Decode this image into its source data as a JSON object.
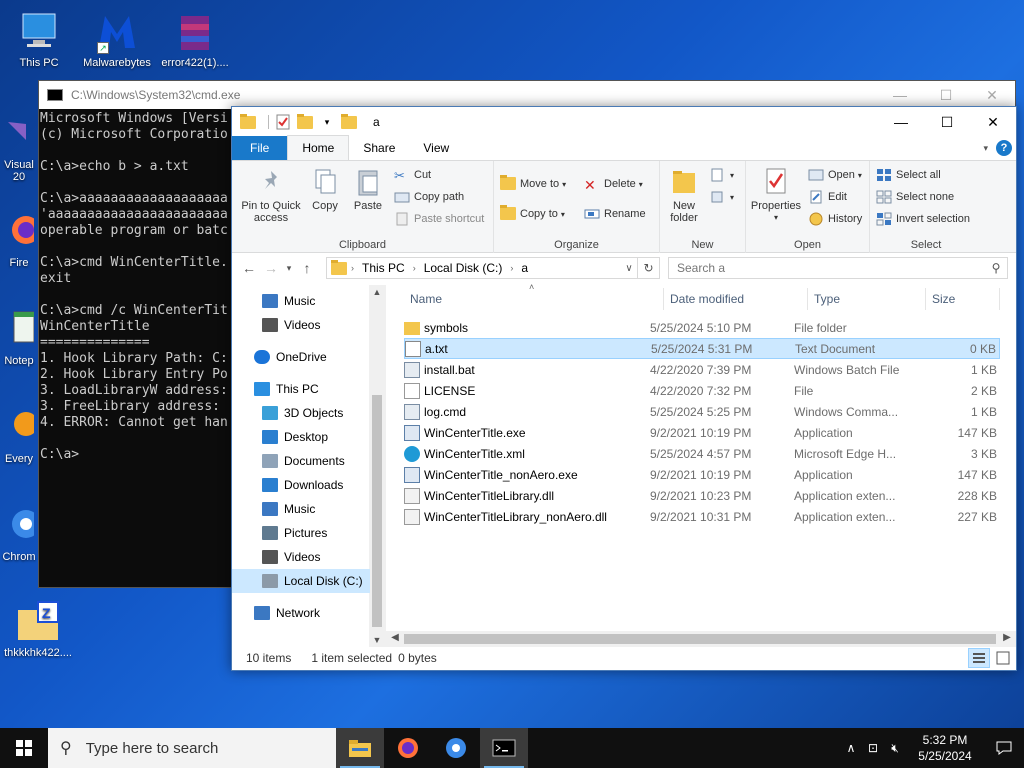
{
  "desktop": {
    "icons": [
      {
        "label": "This PC",
        "icon": "monitor-icon"
      },
      {
        "label": "Malwarebytes",
        "icon": "malwarebytes-icon"
      },
      {
        "label": "error422(1)....",
        "icon": "winrar-archive-icon"
      },
      {
        "label": "Visual 20",
        "icon": "visual-studio-icon"
      },
      {
        "label": "Fire",
        "icon": "firefox-icon"
      },
      {
        "label": "Notep",
        "icon": "notepad-icon"
      },
      {
        "label": "Every",
        "icon": "everything-icon"
      },
      {
        "label": "Chrom",
        "icon": "chrome-icon"
      },
      {
        "label": "thkkkhk422....",
        "icon": "zip-folder-icon"
      }
    ]
  },
  "cmd": {
    "title": "C:\\Windows\\System32\\cmd.exe",
    "lines": [
      "Microsoft Windows [Versi",
      "(c) Microsoft Corporatio",
      "",
      "C:\\a>echo b > a.txt",
      "",
      "C:\\a>aaaaaaaaaaaaaaaaaaa",
      "'aaaaaaaaaaaaaaaaaaaaaaa",
      "operable program or batc",
      "",
      "C:\\a>cmd WinCenterTitle.",
      "exit",
      "",
      "C:\\a>cmd /c WinCenterTit",
      "WinCenterTitle",
      "==============",
      "1. Hook Library Path: C:",
      "2. Hook Library Entry Po",
      "3. LoadLibraryW address:",
      "3. FreeLibrary address: ",
      "4. ERROR: Cannot get han",
      "",
      "C:\\a>"
    ]
  },
  "explorer": {
    "title": "a",
    "tabs": {
      "file": "File",
      "home": "Home",
      "share": "Share",
      "view": "View"
    },
    "ribbon": {
      "clipboard": {
        "label": "Clipboard",
        "pin": "Pin to Quick access",
        "copy": "Copy",
        "paste": "Paste",
        "cut": "Cut",
        "copy_path": "Copy path",
        "paste_shortcut": "Paste shortcut"
      },
      "organize": {
        "label": "Organize",
        "move_to": "Move to",
        "copy_to": "Copy to",
        "delete": "Delete",
        "rename": "Rename"
      },
      "new": {
        "label": "New",
        "new_folder": "New folder"
      },
      "open": {
        "label": "Open",
        "properties": "Properties",
        "open": "Open",
        "edit": "Edit",
        "history": "History"
      },
      "select": {
        "label": "Select",
        "select_all": "Select all",
        "select_none": "Select none",
        "invert": "Invert selection"
      }
    },
    "address": {
      "crumbs": [
        "This PC",
        "Local Disk (C:)",
        "a"
      ]
    },
    "search": {
      "placeholder": "Search a"
    },
    "nav": [
      {
        "label": "Music",
        "icon": "music-icon",
        "indent": 1
      },
      {
        "label": "Videos",
        "icon": "videos-icon",
        "indent": 1
      },
      {
        "label": "OneDrive",
        "icon": "onedrive-icon",
        "indent": 0
      },
      {
        "label": "This PC",
        "icon": "this-pc-icon",
        "indent": 0
      },
      {
        "label": "3D Objects",
        "icon": "3d-objects-icon",
        "indent": 1
      },
      {
        "label": "Desktop",
        "icon": "desktop-icon",
        "indent": 1
      },
      {
        "label": "Documents",
        "icon": "documents-icon",
        "indent": 1
      },
      {
        "label": "Downloads",
        "icon": "downloads-icon",
        "indent": 1
      },
      {
        "label": "Music",
        "icon": "music-icon",
        "indent": 1
      },
      {
        "label": "Pictures",
        "icon": "pictures-icon",
        "indent": 1
      },
      {
        "label": "Videos",
        "icon": "videos-icon",
        "indent": 1
      },
      {
        "label": "Local Disk (C:)",
        "icon": "drive-icon",
        "indent": 1,
        "selected": true
      },
      {
        "label": "Network",
        "icon": "network-icon",
        "indent": 0
      }
    ],
    "columns": {
      "name": "Name",
      "date": "Date modified",
      "type": "Type",
      "size": "Size"
    },
    "files": [
      {
        "name": "symbols",
        "date": "5/25/2024 5:10 PM",
        "type": "File folder",
        "size": "",
        "icon": "folder-icon"
      },
      {
        "name": "a.txt",
        "date": "5/25/2024 5:31 PM",
        "type": "Text Document",
        "size": "0 KB",
        "icon": "text-file-icon",
        "selected": true
      },
      {
        "name": "install.bat",
        "date": "4/22/2020 7:39 PM",
        "type": "Windows Batch File",
        "size": "1 KB",
        "icon": "batch-file-icon"
      },
      {
        "name": "LICENSE",
        "date": "4/22/2020 7:32 PM",
        "type": "File",
        "size": "2 KB",
        "icon": "file-icon"
      },
      {
        "name": "log.cmd",
        "date": "5/25/2024 5:25 PM",
        "type": "Windows Comma...",
        "size": "1 KB",
        "icon": "cmd-file-icon"
      },
      {
        "name": "WinCenterTitle.exe",
        "date": "9/2/2021 10:19 PM",
        "type": "Application",
        "size": "147 KB",
        "icon": "exe-icon"
      },
      {
        "name": "WinCenterTitle.xml",
        "date": "5/25/2024 4:57 PM",
        "type": "Microsoft Edge H...",
        "size": "3 KB",
        "icon": "edge-icon"
      },
      {
        "name": "WinCenterTitle_nonAero.exe",
        "date": "9/2/2021 10:19 PM",
        "type": "Application",
        "size": "147 KB",
        "icon": "exe-icon"
      },
      {
        "name": "WinCenterTitleLibrary.dll",
        "date": "9/2/2021 10:23 PM",
        "type": "Application exten...",
        "size": "228 KB",
        "icon": "dll-icon"
      },
      {
        "name": "WinCenterTitleLibrary_nonAero.dll",
        "date": "9/2/2021 10:31 PM",
        "type": "Application exten...",
        "size": "227 KB",
        "icon": "dll-icon"
      }
    ],
    "status": {
      "count": "10 items",
      "selected": "1 item selected",
      "size": "0 bytes"
    }
  },
  "taskbar": {
    "search_placeholder": "Type here to search",
    "time": "5:32 PM",
    "date": "5/25/2024"
  },
  "colors": {
    "accent": "#1979ca",
    "selection": "#cce8ff",
    "taskbar": "#101010"
  }
}
